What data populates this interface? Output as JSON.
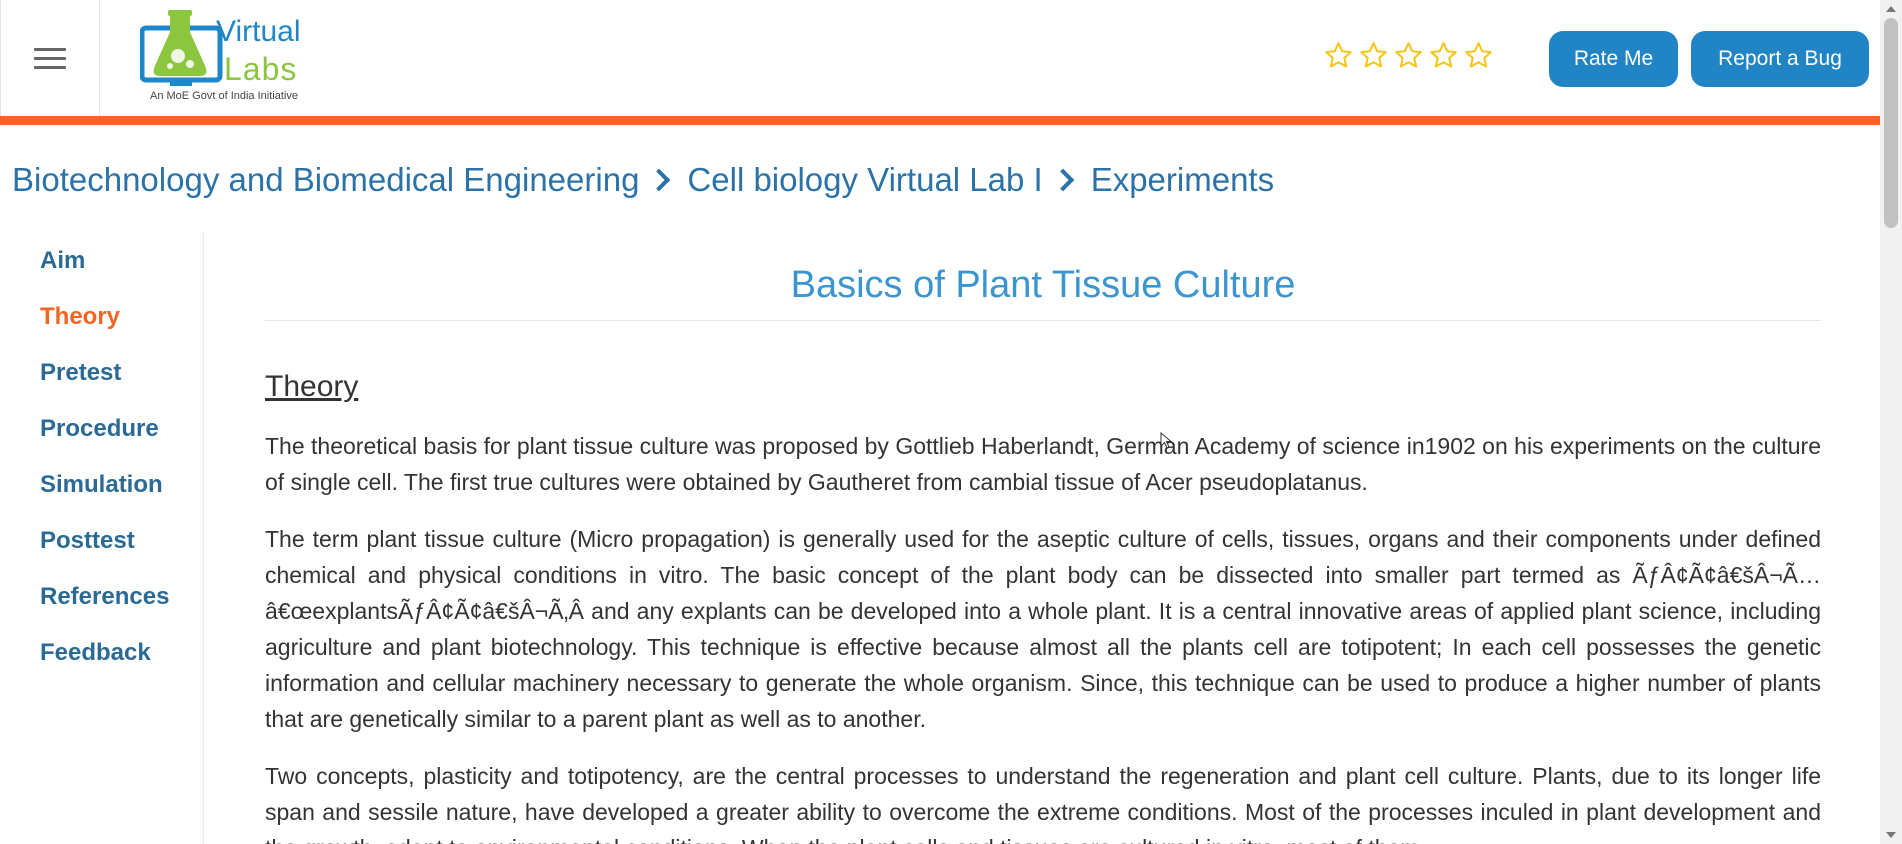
{
  "header": {
    "menu_icon": "hamburger-menu-icon",
    "logo": {
      "word1": "Virtual",
      "word2": "Labs",
      "tagline": "An MoE Govt of India Initiative"
    },
    "rating": {
      "stars_total": 5,
      "stars_filled": 0,
      "icon": "star-outline-icon",
      "color": "#f5c518"
    },
    "rate_button": "Rate Me",
    "bug_button": "Report a Bug",
    "accent_color": "#2185c5",
    "bar_color": "#f26522"
  },
  "breadcrumb": {
    "items": [
      "Biotechnology and Biomedical Engineering",
      "Cell biology Virtual Lab I",
      "Experiments"
    ],
    "separator_icon": "chevron-right-icon"
  },
  "sidebar": {
    "items": [
      {
        "label": "Aim",
        "active": false
      },
      {
        "label": "Theory",
        "active": true
      },
      {
        "label": "Pretest",
        "active": false
      },
      {
        "label": "Procedure",
        "active": false
      },
      {
        "label": "Simulation",
        "active": false
      },
      {
        "label": "Posttest",
        "active": false
      },
      {
        "label": "References",
        "active": false
      },
      {
        "label": "Feedback",
        "active": false
      }
    ]
  },
  "main": {
    "title": "Basics of Plant Tissue Culture",
    "section_heading": "Theory",
    "paragraphs": [
      "The theoretical basis for plant tissue culture was proposed by Gottlieb Haberlandt, German Academy of science in1902 on his experiments on the culture of single cell. The first true cultures were obtained by Gautheret from cambial tissue of Acer pseudoplatanus.",
      "The term plant tissue culture (Micro propagation) is generally used for the aseptic culture of cells, tissues, organs and their components under defined chemical and physical conditions in vitro. The basic concept of the plant body can be dissected into smaller part termed as ÃƒÂ¢Ã¢â€šÂ¬Ã…â€œexplantsÃƒÂ¢Ã¢â€šÂ¬Ã‚Â and any explants can be developed into a whole plant. It is a central innovative areas of applied plant science, including agriculture and plant biotechnology. This technique is effective because almost all the plants cell are totipotent; In each cell possesses the genetic information and cellular machinery necessary to generate the whole organism. Since, this technique can be used to produce a higher number of plants that are genetically similar to a parent plant as well as to another.",
      "Two concepts, plasticity and totipotency, are the central processes to understand the regeneration and plant cell culture. Plants, due to its longer life span and sessile nature, have developed a greater ability to overcome the extreme conditions. Most of the processes inculed in plant development and the growth, adapt to environmental conditions. When the plant cells and tissues are cultured in vitro, most of them"
    ]
  }
}
